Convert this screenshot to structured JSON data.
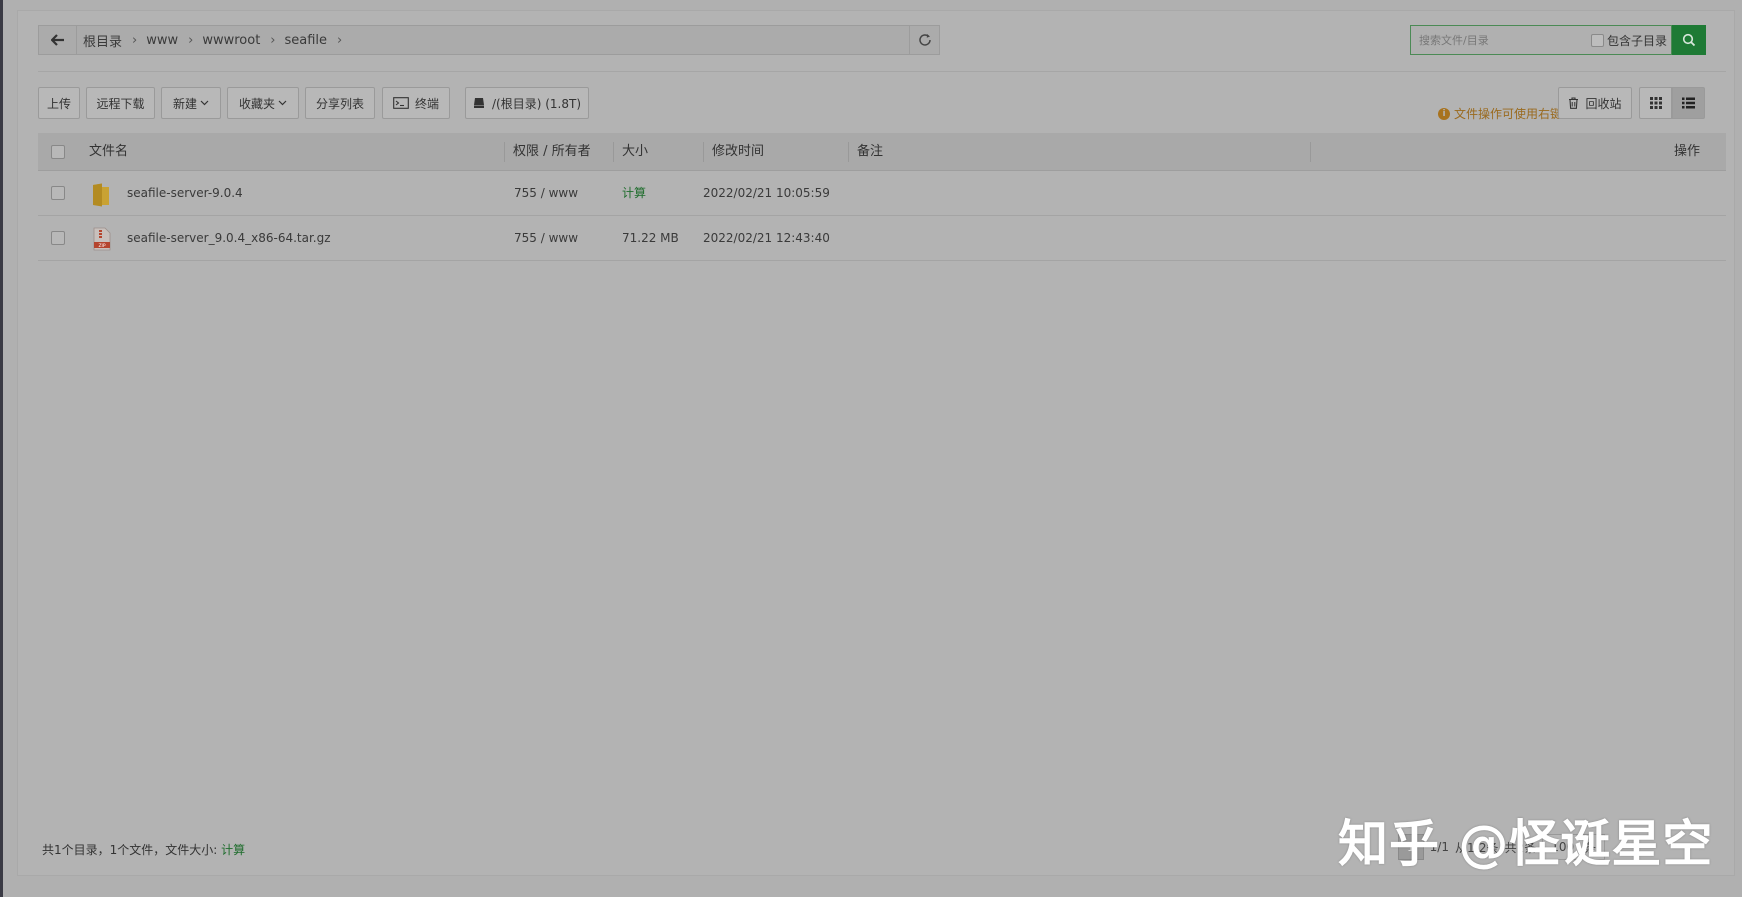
{
  "nav": {
    "breadcrumbs": [
      "根目录",
      "www",
      "wwwroot",
      "seafile"
    ],
    "search_placeholder": "搜索文件/目录",
    "include_subdir_label": "包含子目录"
  },
  "toolbar": {
    "upload": "上传",
    "remote_download": "远程下载",
    "new": "新建",
    "favorites": "收藏夹",
    "share_list": "分享列表",
    "terminal": "终端",
    "disk": "/(根目录) (1.8T)",
    "hint": "文件操作可使用右键",
    "recycle_bin": "回收站"
  },
  "table": {
    "headers": {
      "name": "文件名",
      "perm": "权限 / 所有者",
      "size": "大小",
      "mtime": "修改时间",
      "remark": "备注",
      "ops": "操作"
    },
    "rows": [
      {
        "name": "seafile-server-9.0.4",
        "perm": "755 / www",
        "size": "计算",
        "mtime": "2022/02/21 10:05:59",
        "icon": "folder-icon"
      },
      {
        "name": "seafile-server_9.0.4_x86-64.tar.gz",
        "perm": "755 / www",
        "size": "71.22 MB",
        "mtime": "2022/02/21 12:43:40",
        "icon": "archive-file-icon"
      }
    ]
  },
  "footer": {
    "summary": "共1个目录，1个文件，文件大小:",
    "calc": "计算",
    "page_current": "1",
    "page_info": "1/1",
    "range_info": "从1-2条",
    "total_info": "共2条",
    "per_page": "100",
    "per_page_unit": "条"
  },
  "watermark": "知乎 @怪诞星空",
  "colors": {
    "accent_green": "#1e7a35",
    "hint_orange": "#9a6a1e",
    "folder_yellow": "#c9a233",
    "archive_red": "#b5452e"
  }
}
